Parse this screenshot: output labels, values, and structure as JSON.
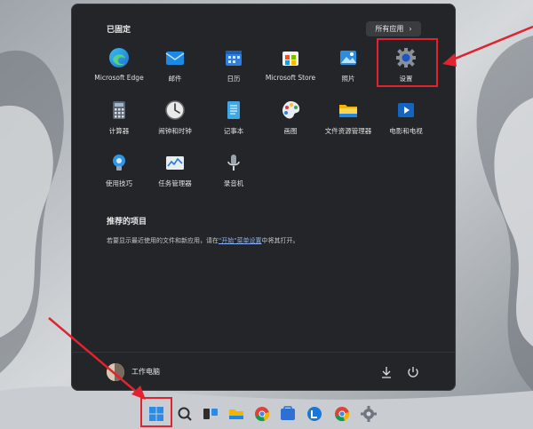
{
  "start_menu": {
    "pinned_title": "已固定",
    "all_apps_label": "所有应用",
    "pinned_apps": [
      {
        "label": "Microsoft Edge",
        "icon": "edge-icon"
      },
      {
        "label": "邮件",
        "icon": "mail-icon"
      },
      {
        "label": "日历",
        "icon": "calendar-icon"
      },
      {
        "label": "Microsoft Store",
        "icon": "store-icon"
      },
      {
        "label": "照片",
        "icon": "photos-icon"
      },
      {
        "label": "设置",
        "icon": "settings-gear-icon"
      },
      {
        "label": "计算器",
        "icon": "calculator-icon"
      },
      {
        "label": "闹钟和时钟",
        "icon": "clock-icon"
      },
      {
        "label": "记事本",
        "icon": "notepad-icon"
      },
      {
        "label": "画图",
        "icon": "paint-icon"
      },
      {
        "label": "文件资源管理器",
        "icon": "folder-icon"
      },
      {
        "label": "电影和电视",
        "icon": "movies-icon"
      },
      {
        "label": "使用技巧",
        "icon": "tips-icon"
      },
      {
        "label": "任务管理器",
        "icon": "task-manager-icon"
      },
      {
        "label": "录音机",
        "icon": "recorder-icon"
      }
    ],
    "recommended_title": "推荐的项目",
    "recommended_text_before": "若要显示最近使用的文件和新应用，请在",
    "recommended_link": "\"开始\"菜单设置",
    "recommended_text_after": "中将其打开。",
    "user_name": "工作电脑"
  },
  "taskbar": {
    "items": [
      "start-windows-icon",
      "search-icon",
      "task-view-icon",
      "file-explorer-icon",
      "chrome-icon",
      "store-icon",
      "mail-icon",
      "app-icon",
      "chrome-icon",
      "settings-gear-icon"
    ]
  },
  "colors": {
    "accent_red": "#e0242f",
    "menu_bg": "#232528",
    "link": "#8ab4f8"
  }
}
